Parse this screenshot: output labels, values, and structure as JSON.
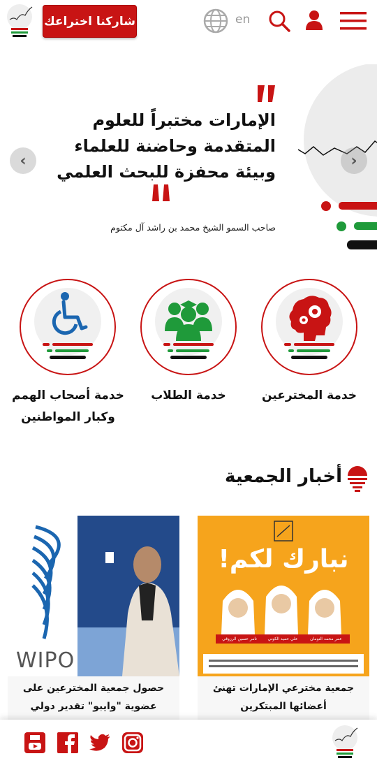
{
  "header": {
    "cta_label": "شاركنا اختراعك",
    "lang_label": "en",
    "icons": [
      "logo",
      "globe-icon",
      "search-icon",
      "user-icon",
      "menu-icon"
    ]
  },
  "hero": {
    "quote": "الإمارات مختبراً للعلوم المتقدمة وحاضنة للعلماء وبيئة محفزة للبحث العلمي",
    "author": "صاحب السمو الشيخ محمد بن راشد آل مكتوم"
  },
  "services": [
    {
      "label": "خدمة المخترعين",
      "icon": "brain-gears-icon"
    },
    {
      "label": "خدمة الطلاب",
      "icon": "students-icon"
    },
    {
      "label": "خدمة أصحاب الهمم وكبار المواطنين",
      "icon": "wheelchair-icon"
    }
  ],
  "news": {
    "title": "أخبار الجمعية",
    "items": [
      {
        "title": "جمعية مخترعي الإمارات تهنئ أعضائها المبتكرين",
        "image": {
          "headline": "نبارك لكم!",
          "names": [
            "عمر محمد النومان",
            "علي حميد الكوني",
            "تامر حسين الرزوقي"
          ]
        }
      },
      {
        "title": "حصول جمعية المخترعين على عضوية \"وايبو\" تقدير دولي لإنجازاتها بدعم وزارة الاقتصاد",
        "image": {
          "label": "WIPO"
        }
      }
    ]
  },
  "footer": {
    "social": [
      "youtube-icon",
      "facebook-icon",
      "twitter-icon",
      "instagram-icon"
    ]
  },
  "colors": {
    "brand_red": "#c81414",
    "uae_green": "#1f9a3a",
    "black": "#111111"
  }
}
